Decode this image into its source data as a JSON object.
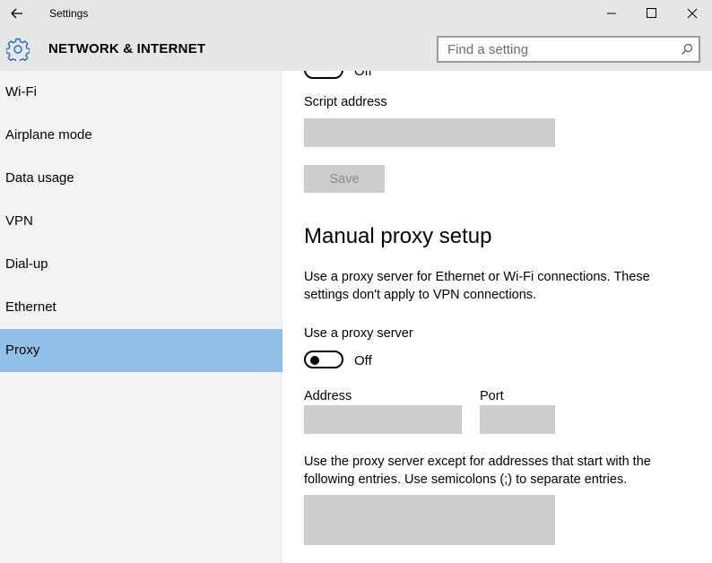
{
  "window": {
    "title": "Settings",
    "back_icon": "back-arrow-icon",
    "minimize_icon": "minimize-icon",
    "maximize_icon": "maximize-icon",
    "close_icon": "close-icon"
  },
  "header": {
    "icon": "gear-icon",
    "title": "NETWORK & INTERNET",
    "search_placeholder": "Find a setting",
    "search_icon": "search-icon",
    "search_value": ""
  },
  "sidebar": {
    "items": [
      {
        "label": "Wi-Fi",
        "active": false
      },
      {
        "label": "Airplane mode",
        "active": false
      },
      {
        "label": "Data usage",
        "active": false
      },
      {
        "label": "VPN",
        "active": false
      },
      {
        "label": "Dial-up",
        "active": false
      },
      {
        "label": "Ethernet",
        "active": false
      },
      {
        "label": "Proxy",
        "active": true
      }
    ],
    "active_color": "#92c0ea"
  },
  "content": {
    "partial_toggle_state": "Off",
    "script_address_label": "Script address",
    "script_address_value": "",
    "save_label": "Save",
    "manual_heading": "Manual proxy setup",
    "manual_description": "Use a proxy server for Ethernet or Wi-Fi connections. These settings don't apply to VPN connections.",
    "use_proxy_label": "Use a proxy server",
    "use_proxy_state": "Off",
    "use_proxy_on": false,
    "address_label": "Address",
    "address_value": "",
    "port_label": "Port",
    "port_value": "",
    "exceptions_description": "Use the proxy server except for addresses that start with the following entries. Use semicolons (;) to separate entries.",
    "exceptions_value": ""
  }
}
